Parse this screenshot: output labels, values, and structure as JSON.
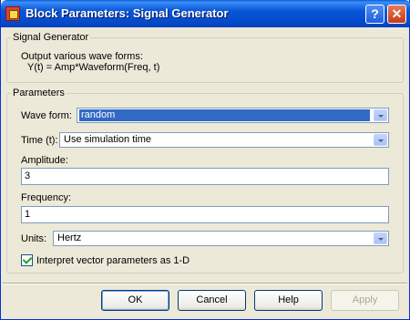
{
  "window": {
    "title": "Block Parameters: Signal Generator",
    "help_glyph": "?",
    "close_glyph": "✕"
  },
  "block_group": {
    "legend": "Signal Generator",
    "description_line1": "Output various wave forms:",
    "description_line2": "Y(t) = Amp*Waveform(Freq, t)"
  },
  "params_group": {
    "legend": "Parameters",
    "waveform": {
      "label": "Wave form:",
      "value": "random"
    },
    "time": {
      "label": "Time (t):",
      "value": "Use simulation time"
    },
    "amplitude": {
      "label": "Amplitude:",
      "value": "3"
    },
    "frequency": {
      "label": "Frequency:",
      "value": "1"
    },
    "units": {
      "label": "Units:",
      "value": "Hertz"
    },
    "interpret_checkbox": {
      "label": "Interpret vector parameters as 1-D",
      "checked": true
    }
  },
  "buttons": {
    "ok": "OK",
    "cancel": "Cancel",
    "help": "Help",
    "apply": "Apply"
  }
}
